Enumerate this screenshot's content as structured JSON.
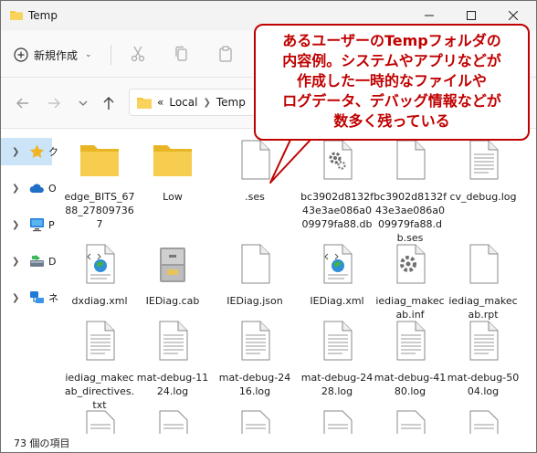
{
  "window": {
    "title": "Temp"
  },
  "toolbar": {
    "new_label": "新規作成"
  },
  "address": {
    "overflow": "«",
    "crumbs": [
      "Local",
      "Temp"
    ]
  },
  "nav": {
    "items": [
      {
        "label": "ク",
        "icon": "star-icon",
        "selected": true
      },
      {
        "label": "O",
        "icon": "cloud-icon",
        "selected": false
      },
      {
        "label": "P",
        "icon": "monitor-icon",
        "selected": false
      },
      {
        "label": "D",
        "icon": "drive-icon",
        "selected": false
      },
      {
        "label": "ネ",
        "icon": "network-icon",
        "selected": false
      }
    ]
  },
  "files": [
    {
      "name": "edge_BITS_6788_278097367",
      "icon": "folder-icon"
    },
    {
      "name": "Low",
      "icon": "folder-icon"
    },
    {
      "name": ".ses",
      "icon": "document-icon"
    },
    {
      "name": "bc3902d8132f43e3ae086a009979fa88.db",
      "icon": "settings-file-icon"
    },
    {
      "name": "bc3902d8132f43e3ae086a009979fa88.db.ses",
      "icon": "document-icon"
    },
    {
      "name": "cv_debug.log",
      "icon": "text-file-icon"
    },
    {
      "name": "dxdiag.xml",
      "icon": "xml-file-icon"
    },
    {
      "name": "IEDiag.cab",
      "icon": "cabinet-icon"
    },
    {
      "name": "IEDiag.json",
      "icon": "document-icon"
    },
    {
      "name": "IEDiag.xml",
      "icon": "xml-file-icon"
    },
    {
      "name": "iediag_makecab.inf",
      "icon": "setup-info-icon"
    },
    {
      "name": "iediag_makecab.rpt",
      "icon": "document-icon"
    },
    {
      "name": "iediag_makecab_directives.txt",
      "icon": "text-file-icon"
    },
    {
      "name": "mat-debug-1124.log",
      "icon": "text-file-icon"
    },
    {
      "name": "mat-debug-2416.log",
      "icon": "text-file-icon"
    },
    {
      "name": "mat-debug-2428.log",
      "icon": "text-file-icon"
    },
    {
      "name": "mat-debug-4180.log",
      "icon": "text-file-icon"
    },
    {
      "name": "mat-debug-5004.log",
      "icon": "text-file-icon"
    }
  ],
  "status": {
    "count": "73 個の項目"
  },
  "callout": {
    "lines": [
      "あるユーザーのTempフォルダの",
      "内容例。システムやアプリなどが",
      "作成した一時的なファイルや",
      "ログデータ、デバッグ情報などが",
      "数多く残っている"
    ]
  },
  "colors": {
    "accent": "#c00000",
    "folder": "#f5c842",
    "selection": "#cce4f7"
  }
}
